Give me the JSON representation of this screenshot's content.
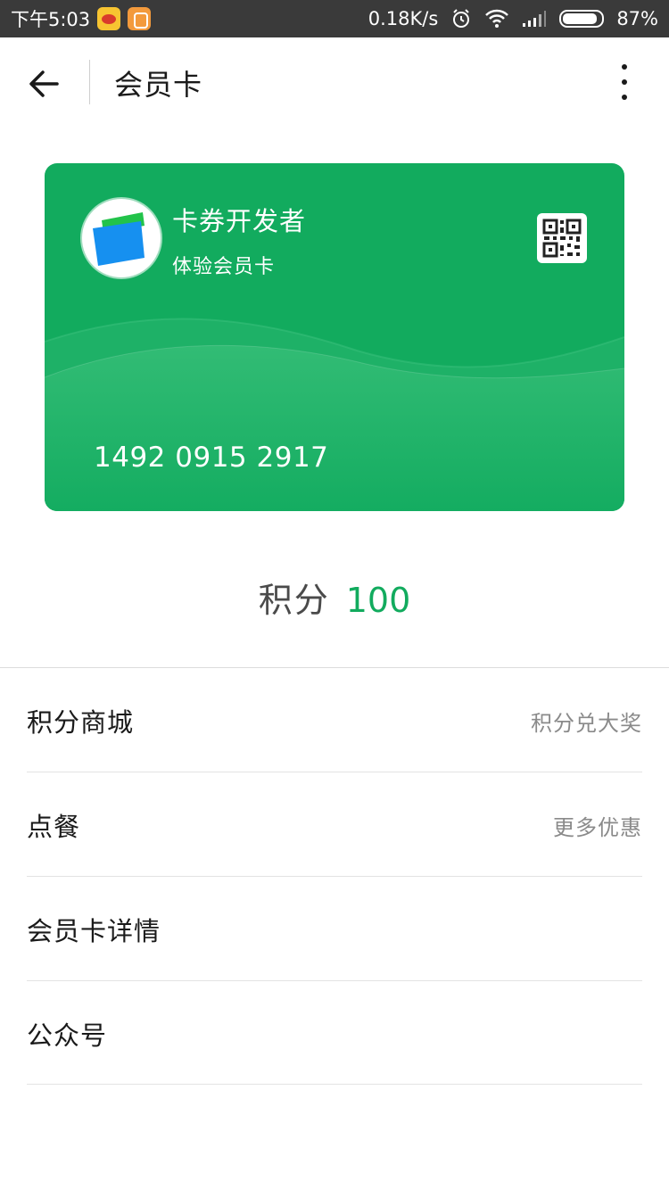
{
  "status_bar": {
    "time": "下午5:03",
    "network_speed": "0.18K/s",
    "battery": "87%"
  },
  "header": {
    "title": "会员卡"
  },
  "card": {
    "brand": "卡券开发者",
    "name": "体验会员卡",
    "number": "1492 0915 2917",
    "background_color": "#12ab5e"
  },
  "points": {
    "label": "积分",
    "value": "100",
    "value_color": "#12ab5e"
  },
  "menu": [
    {
      "label": "积分商城",
      "hint": "积分兑大奖"
    },
    {
      "label": "点餐",
      "hint": "更多优惠"
    },
    {
      "label": "会员卡详情",
      "hint": ""
    },
    {
      "label": "公众号",
      "hint": ""
    }
  ]
}
